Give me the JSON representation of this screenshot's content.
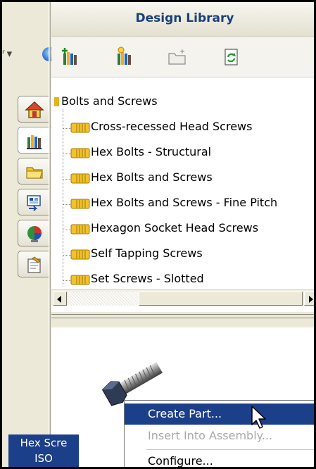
{
  "left_strip": {
    "dropdown_glyph": "ʳ ▾"
  },
  "side_tabs": [
    {
      "icon": "home-icon"
    },
    {
      "icon": "design-library-icon",
      "active": true
    },
    {
      "icon": "folder-icon"
    },
    {
      "icon": "view-palette-icon"
    },
    {
      "icon": "appearances-icon"
    },
    {
      "icon": "custom-properties-icon"
    }
  ],
  "panel": {
    "title": "Design Library"
  },
  "toolbar": {
    "buttons": [
      "add-to-library-icon",
      "add-location-icon",
      "create-new-folder-icon",
      "refresh-icon"
    ]
  },
  "tree": {
    "root_label": "Bolts and Screws",
    "items": [
      {
        "label": "Cross-recessed Head Screws"
      },
      {
        "label": "Hex Bolts - Structural"
      },
      {
        "label": "Hex Bolts and Screws"
      },
      {
        "label": "Hex Bolts and Screws - Fine Pitch"
      },
      {
        "label": "Hexagon Socket Head Screws"
      },
      {
        "label": "Self Tapping Screws"
      },
      {
        "label": "Set Screws - Slotted"
      }
    ]
  },
  "preview": {
    "caption_line1": "Hex Scre",
    "caption_line2": "ISO"
  },
  "context_menu": {
    "items": [
      {
        "label": "Create Part...",
        "state": "selected"
      },
      {
        "label": "Insert Into Assembly...",
        "state": "disabled"
      },
      {
        "label": "Configure...",
        "state": "normal"
      }
    ]
  },
  "colors": {
    "selection": "#1c3f8a",
    "folder": "#e8b21a",
    "header_text": "#1a3f7a"
  }
}
